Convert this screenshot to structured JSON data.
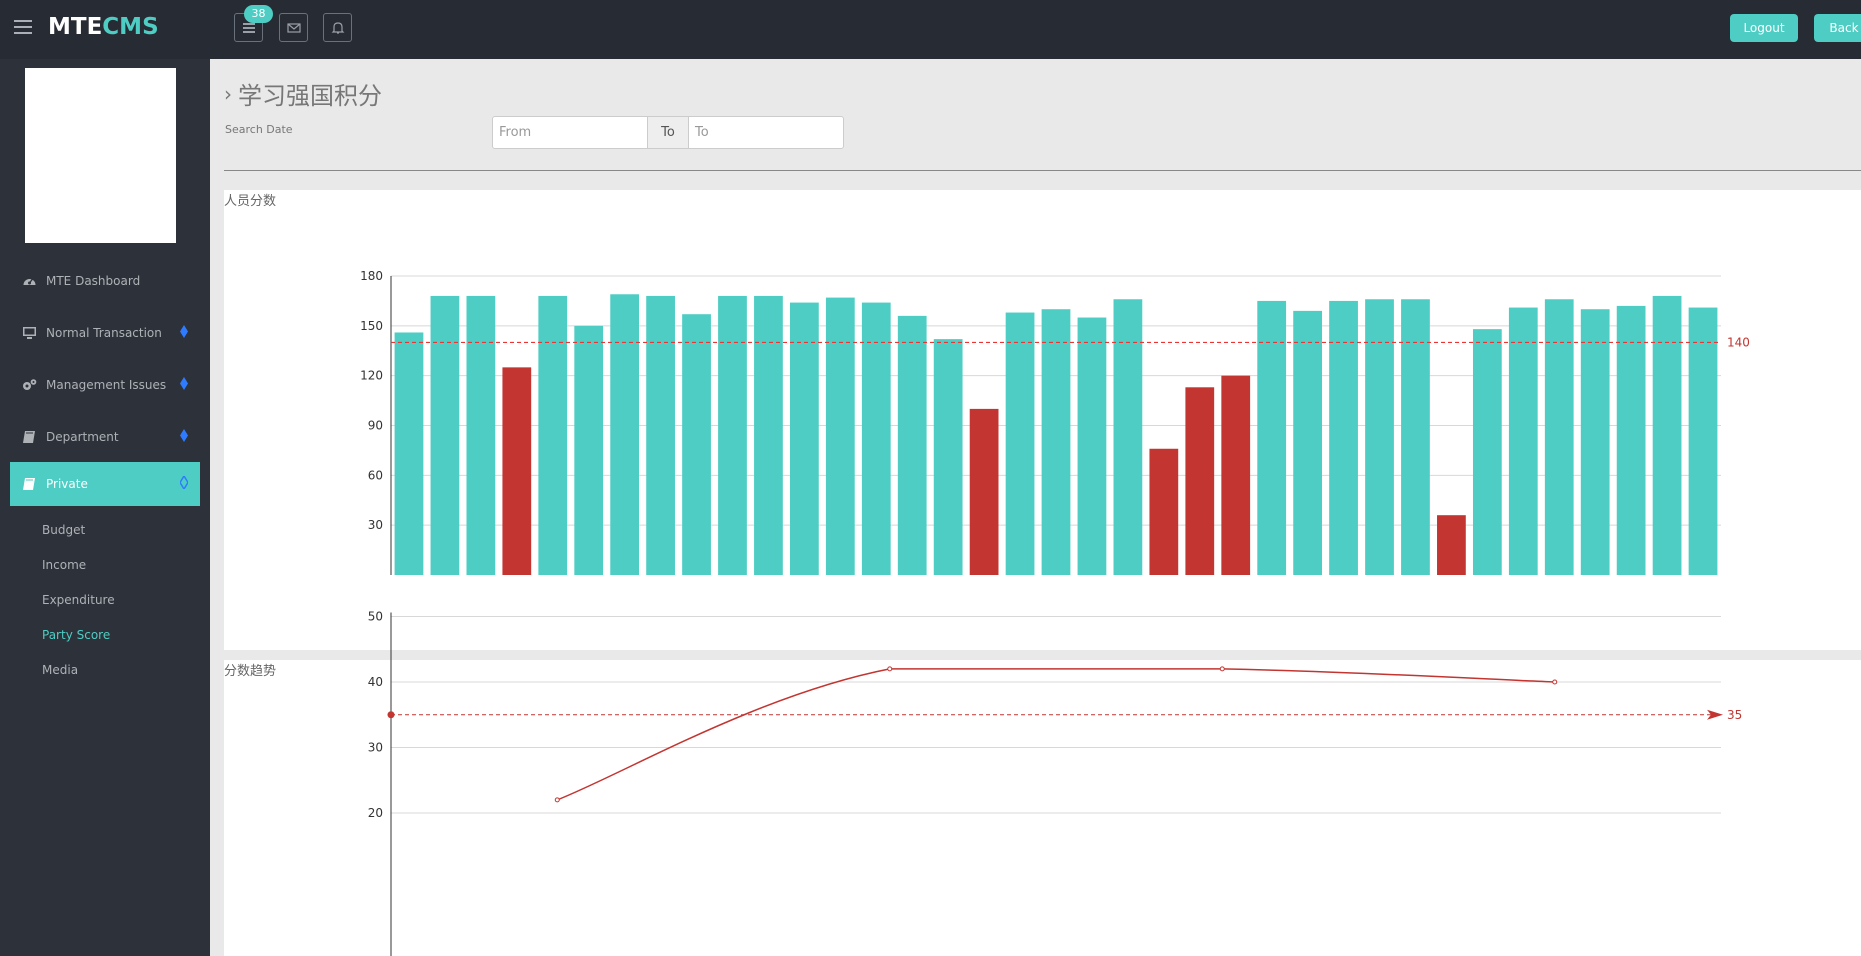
{
  "brand": {
    "part1": "MTE",
    "part2": "CMS"
  },
  "header": {
    "badge_count": "38",
    "logout_label": "Logout",
    "back_label": "Back"
  },
  "sidebar": {
    "items": [
      {
        "label": "MTE Dashboard",
        "icon": "dashboard-icon"
      },
      {
        "label": "Normal Transaction",
        "icon": "desktop-icon"
      },
      {
        "label": "Management Issues",
        "icon": "cogs-icon"
      },
      {
        "label": "Department",
        "icon": "book-icon"
      },
      {
        "label": "Private",
        "icon": "book-icon"
      }
    ],
    "subitems": [
      {
        "label": "Budget"
      },
      {
        "label": "Income"
      },
      {
        "label": "Expenditure"
      },
      {
        "label": "Party Score"
      },
      {
        "label": "Media"
      }
    ]
  },
  "page": {
    "title": "学习强国积分",
    "search_label": "Search Date",
    "from_placeholder": "From",
    "to_label": "To",
    "to_placeholder": "To"
  },
  "colors": {
    "accent": "#4ecdc4",
    "bar_normal": "#4ecdc4",
    "bar_low": "#c23531",
    "line": "#c23531",
    "topbar": "#272b33",
    "sidebar": "#2d3139"
  },
  "chart_data": [
    {
      "type": "bar",
      "title": "人员分数",
      "ylim": [
        0,
        180
      ],
      "yticks": [
        30,
        60,
        90,
        120,
        150,
        180
      ],
      "markline": 140,
      "grid": true,
      "values": [
        146,
        168,
        168,
        125,
        168,
        150,
        169,
        168,
        157,
        168,
        168,
        164,
        167,
        164,
        156,
        142,
        100,
        158,
        160,
        155,
        166,
        76,
        113,
        120,
        165,
        159,
        165,
        166,
        166,
        36,
        148,
        161,
        166,
        160,
        162,
        168,
        161
      ]
    },
    {
      "type": "line",
      "title": "分数趋势",
      "yticks": [
        20,
        30,
        40,
        50
      ],
      "markline": 35,
      "grid": true,
      "values": [
        22,
        42,
        42,
        40
      ]
    }
  ]
}
